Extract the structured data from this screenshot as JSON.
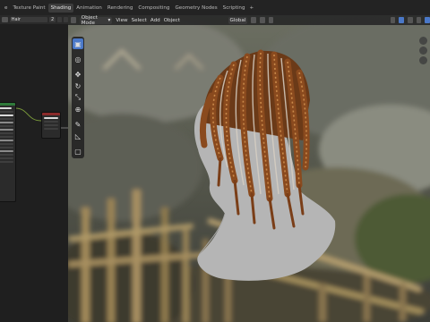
{
  "tabs": [
    "e",
    "Texture Paint",
    "Shading",
    "Animation",
    "Rendering",
    "Compositing",
    "Geometry Nodes",
    "Scripting",
    "+"
  ],
  "active_tab": "Shading",
  "left_panel": {
    "material_name": "Hair",
    "user_count": "2"
  },
  "viewport_header": {
    "mode": "Object Mode",
    "menus": [
      "View",
      "Select",
      "Add",
      "Object"
    ],
    "orientation": "Global"
  },
  "tools": [
    {
      "name": "select-box",
      "glyph": "▣"
    },
    {
      "name": "cursor",
      "glyph": "◎"
    },
    {
      "name": "move",
      "glyph": "✥"
    },
    {
      "name": "rotate",
      "glyph": "↻"
    },
    {
      "name": "scale",
      "glyph": "⤡"
    },
    {
      "name": "transform",
      "glyph": "⊕"
    },
    {
      "name": "annotate",
      "glyph": "✎"
    },
    {
      "name": "measure",
      "glyph": "◺"
    },
    {
      "name": "add-cube",
      "glyph": "▢"
    }
  ],
  "colors": {
    "accent": "#4a78c8",
    "hair": "#8a4a1e",
    "mannequin": "#b5b5b5"
  }
}
